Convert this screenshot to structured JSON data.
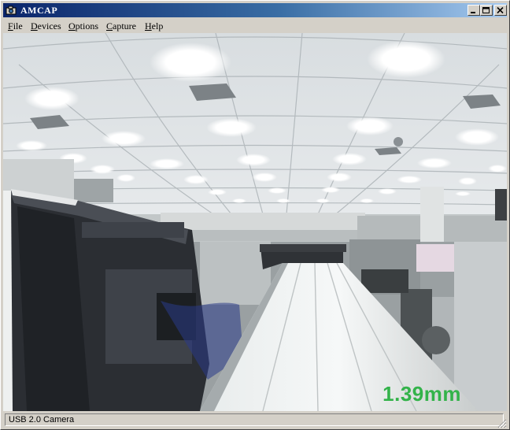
{
  "window": {
    "title": "AMCAP",
    "icon": "camera-icon",
    "controls": [
      "minimize-icon",
      "maximize-icon",
      "close-icon"
    ]
  },
  "menu": {
    "items": [
      {
        "label": "File"
      },
      {
        "label": "Devices"
      },
      {
        "label": "Options"
      },
      {
        "label": "Capture"
      },
      {
        "label": "Help"
      }
    ]
  },
  "preview": {
    "overlay_text": "1.39mm",
    "overlay_color": "#33b34a"
  },
  "status": {
    "device": "USB 2.0 Camera"
  }
}
